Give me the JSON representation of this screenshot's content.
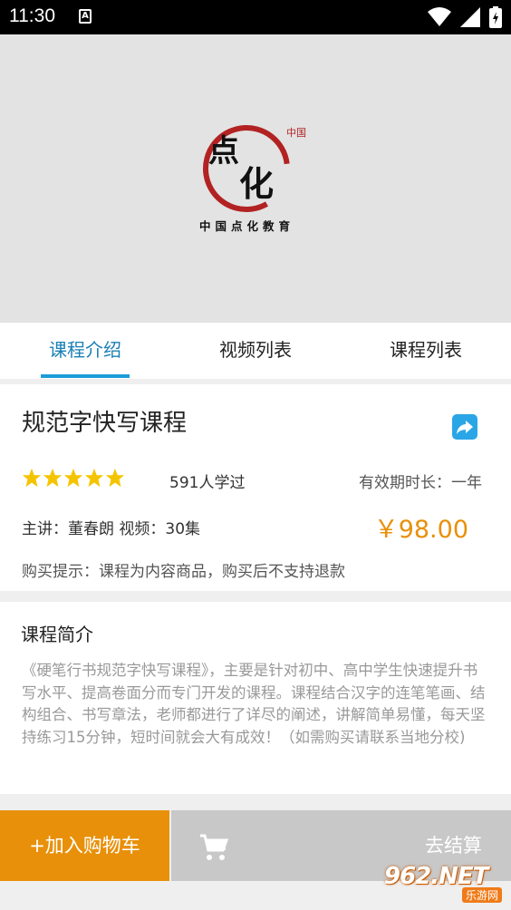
{
  "status_bar": {
    "time": "11:30",
    "notification_badge": "A",
    "icons": [
      "wifi-icon",
      "signal-icon",
      "battery-icon"
    ]
  },
  "banner": {
    "logo_main": "点化",
    "logo_seal": "中国",
    "logo_caption": "中国点化教育"
  },
  "tabs": [
    {
      "label": "课程介绍",
      "active": true
    },
    {
      "label": "视频列表",
      "active": false
    },
    {
      "label": "课程列表",
      "active": false
    }
  ],
  "course": {
    "title": "规范字快写课程",
    "rating": 5,
    "learned_count": "591人学过",
    "validity": "有效期时长：一年",
    "teacher_videos": "主讲：董春朗  视频：30集",
    "price": "￥98.00",
    "purchase_tip": "购买提示：课程为内容商品，购买后不支持退款"
  },
  "intro": {
    "title": "课程简介",
    "text": "《硬笔行书规范字快写课程》，主要是针对初中、高中学生快速提升书写水平、提高卷面分而专门开发的课程。课程结合汉字的连笔笔画、结构组合、书写章法，老师都进行了详尽的阐述，讲解简单易懂，每天坚持练习15分钟，短时间就会大有成效！（如需购买请联系当地分校)"
  },
  "bottom_bar": {
    "add_to_cart": "+加入购物车",
    "checkout": "去结算"
  },
  "watermark": {
    "main": "962.NET",
    "sub": "乐游网"
  },
  "colors": {
    "accent_blue": "#1a7fb5",
    "price_orange": "#e8900a",
    "star_yellow": "#f5c400",
    "share_blue": "#2aa6e6"
  }
}
